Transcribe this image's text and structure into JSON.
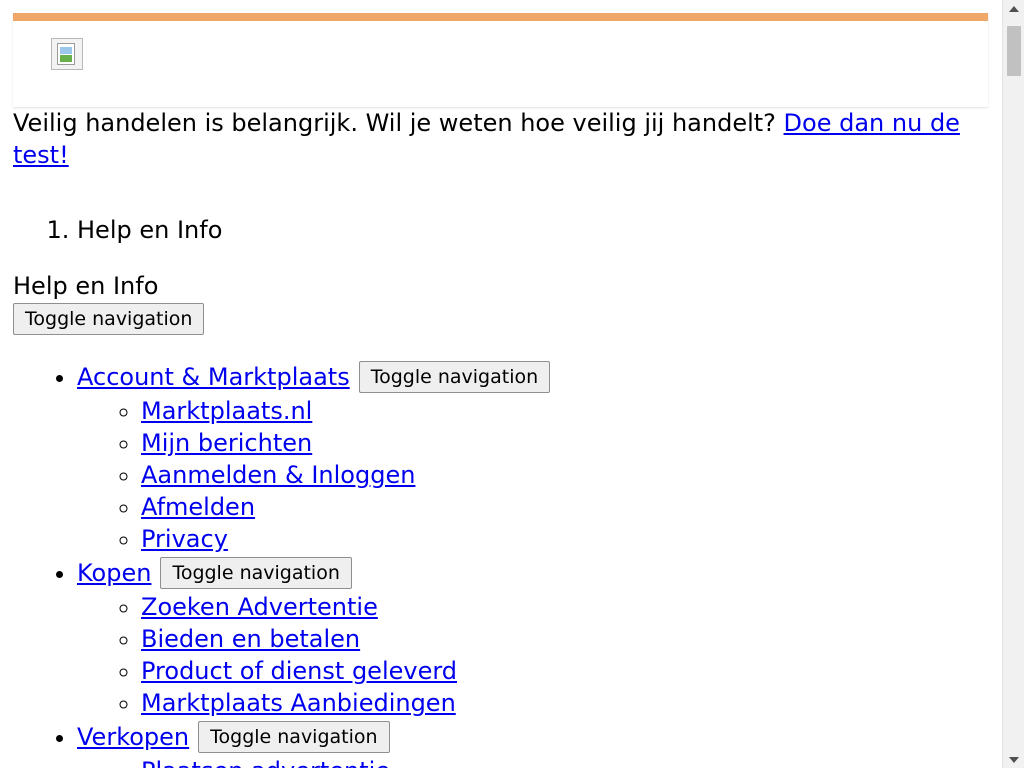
{
  "colors": {
    "header_accent": "#f0a868",
    "link": "#0000ee"
  },
  "header": {
    "logo_icon": "broken-image-icon"
  },
  "notice": {
    "text": "Veilig handelen is belangrijk. Wil je weten hoe veilig jij handelt? ",
    "link_label": "Doe dan nu de test!"
  },
  "breadcrumb": {
    "items": [
      "Help en Info"
    ]
  },
  "help": {
    "title": "Help en Info",
    "toggle_label": "Toggle navigation"
  },
  "nav": {
    "sections": [
      {
        "label": "Account & Marktplaats",
        "toggle_label": "Toggle navigation",
        "items": [
          "Marktplaats.nl",
          "Mijn berichten",
          "Aanmelden & Inloggen",
          "Afmelden",
          "Privacy"
        ]
      },
      {
        "label": "Kopen",
        "toggle_label": "Toggle navigation",
        "items": [
          "Zoeken Advertentie",
          "Bieden en betalen",
          "Product of dienst geleverd",
          "Marktplaats Aanbiedingen"
        ]
      },
      {
        "label": "Verkopen",
        "toggle_label": "Toggle navigation",
        "items": [
          "Plaatsen advertentie"
        ]
      }
    ]
  }
}
